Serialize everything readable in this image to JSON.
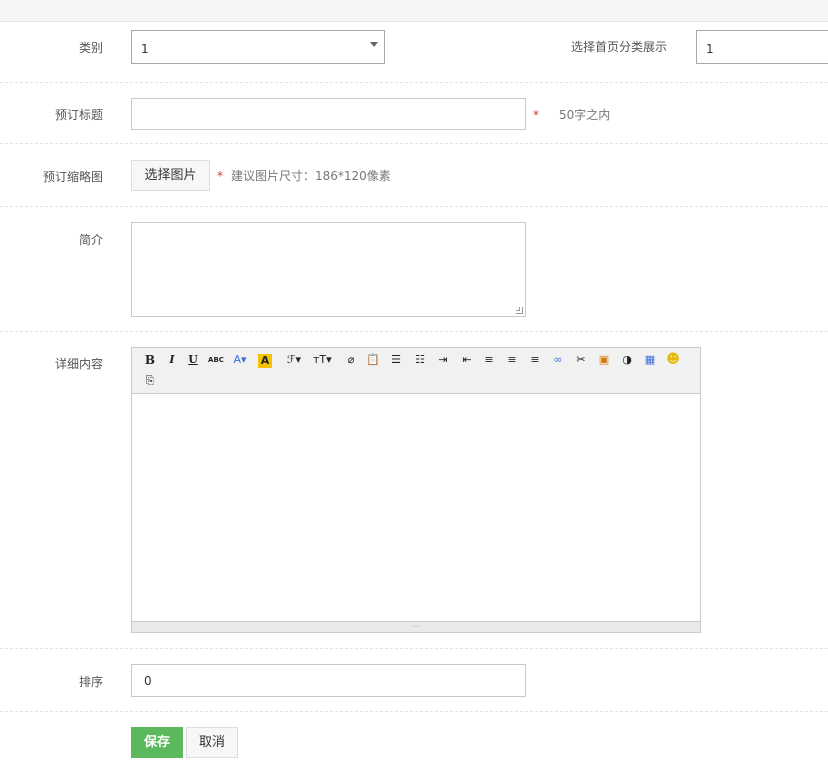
{
  "form": {
    "category": {
      "label": "类别",
      "value": "1"
    },
    "homepage_category": {
      "label": "选择首页分类展示",
      "value": "1"
    },
    "title": {
      "label": "预订标题",
      "value": "",
      "required_mark": "*",
      "hint": "50字之内"
    },
    "thumbnail": {
      "label": "预订缩略图",
      "button_label": "选择图片",
      "required_mark": "*",
      "hint": "建议图片尺寸：186*120像素"
    },
    "intro": {
      "label": "简介",
      "value": ""
    },
    "details": {
      "label": "详细内容"
    },
    "sort": {
      "label": "排序",
      "value": "0"
    }
  },
  "editor_toolbar": {
    "buttons": [
      {
        "name": "bold-icon",
        "glyph": "B"
      },
      {
        "name": "italic-icon",
        "glyph": "I"
      },
      {
        "name": "underline-icon",
        "glyph": "U"
      },
      {
        "name": "strikethrough-icon",
        "glyph": "ABC"
      },
      {
        "name": "font-color-icon",
        "glyph": "A▾"
      },
      {
        "name": "highlight-color-icon",
        "glyph": "A"
      },
      {
        "name": "font-family-icon",
        "glyph": "ℱ▾"
      },
      {
        "name": "font-size-icon",
        "glyph": "тT▾"
      },
      {
        "name": "eraser-icon",
        "glyph": "⌀"
      },
      {
        "name": "paste-word-icon",
        "glyph": "📋"
      },
      {
        "name": "ordered-list-icon",
        "glyph": "☰"
      },
      {
        "name": "unordered-list-icon",
        "glyph": "☷"
      },
      {
        "name": "indent-icon",
        "glyph": "⇥"
      },
      {
        "name": "outdent-icon",
        "glyph": "⇤"
      },
      {
        "name": "align-left-icon",
        "glyph": "≡"
      },
      {
        "name": "align-center-icon",
        "glyph": "≡"
      },
      {
        "name": "align-right-icon",
        "glyph": "≡"
      },
      {
        "name": "link-icon",
        "glyph": "∞"
      },
      {
        "name": "unlink-icon",
        "glyph": "✂"
      },
      {
        "name": "image-icon",
        "glyph": "▣"
      },
      {
        "name": "flash-icon",
        "glyph": "◑"
      },
      {
        "name": "table-icon",
        "glyph": "▦"
      },
      {
        "name": "emoticon-icon",
        "glyph": "☻"
      },
      {
        "name": "paste-text-icon",
        "glyph": "⎘"
      }
    ]
  },
  "actions": {
    "save_label": "保存",
    "cancel_label": "取消"
  },
  "colors": {
    "primary": "#5cb85c",
    "required": "#e53935",
    "highlight": "#f5c400"
  }
}
